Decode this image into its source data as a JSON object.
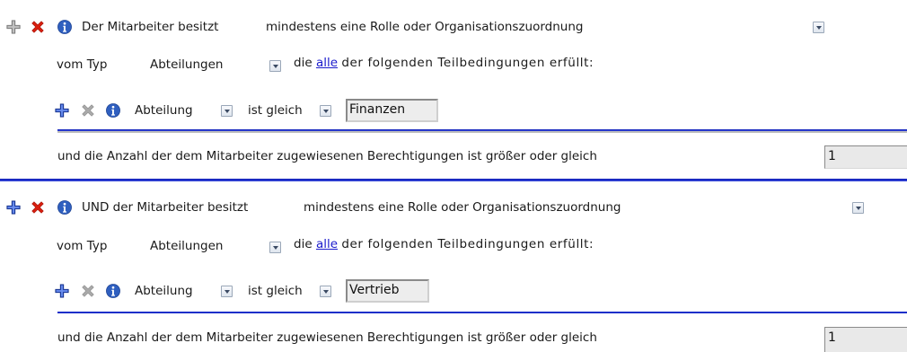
{
  "blocks": [
    {
      "condition_text": "Der Mitarbeiter besitzt",
      "condition_value": "mindestens eine Rolle oder Organisationszuordnung",
      "type_prefix": "vom Typ",
      "type_value": "Abteilungen",
      "sub_prefix": "die",
      "sub_link": "alle",
      "sub_suffix": "der folgenden Teilbedingungen erfüllt:",
      "sub_field": "Abteilung",
      "sub_operator": "ist gleich",
      "sub_value": "Finanzen",
      "count_text": "und die Anzahl der dem Mitarbeiter zugewiesenen Berechtigungen ist größer oder gleich",
      "count_value": "1"
    },
    {
      "condition_text": "UND der Mitarbeiter besitzt",
      "condition_value": "mindestens eine Rolle oder Organisationszuordnung",
      "type_prefix": "vom Typ",
      "type_value": "Abteilungen",
      "sub_prefix": "die",
      "sub_link": "alle",
      "sub_suffix": "der folgenden Teilbedingungen erfüllt:",
      "sub_field": "Abteilung",
      "sub_operator": "ist gleich",
      "sub_value": "Vertrieb",
      "count_text": "und die Anzahl der dem Mitarbeiter zugewiesenen Berechtigungen ist größer oder gleich",
      "count_value": "1"
    }
  ],
  "icons": {
    "add": "plus-icon",
    "delete": "delete-icon",
    "info": "info-icon"
  },
  "colors": {
    "add_active": "#2e4fb8",
    "add_disabled": "#9b9b9b",
    "delete_active": "#d81e0e",
    "delete_disabled": "#a9a9a9",
    "info": "#2f5fbf",
    "link": "#1a1acc",
    "separator": "#0c1bb5"
  }
}
